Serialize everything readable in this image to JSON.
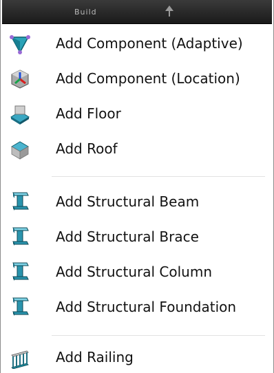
{
  "menu": {
    "header": {
      "title": "Build",
      "arrow_icon": "arrow-up-icon"
    },
    "items": [
      {
        "label": "Add Component (Adaptive)",
        "icon": "adaptive-component-icon"
      },
      {
        "label": "Add Component (Location)",
        "icon": "location-component-icon"
      },
      {
        "label": "Add Floor",
        "icon": "floor-icon"
      },
      {
        "label": "Add Roof",
        "icon": "roof-icon"
      },
      {
        "label": "Add Structural Beam",
        "icon": "structural-beam-icon"
      },
      {
        "label": "Add Structural Brace",
        "icon": "structural-brace-icon"
      },
      {
        "label": "Add Structural Column",
        "icon": "structural-column-icon"
      },
      {
        "label": "Add Structural Foundation",
        "icon": "structural-foundation-icon"
      },
      {
        "label": "Add Railing",
        "icon": "railing-icon"
      }
    ]
  },
  "colors": {
    "header_bg": "#1f1f1f",
    "teal_icon": "#1f8fa0",
    "text": "#111111"
  }
}
